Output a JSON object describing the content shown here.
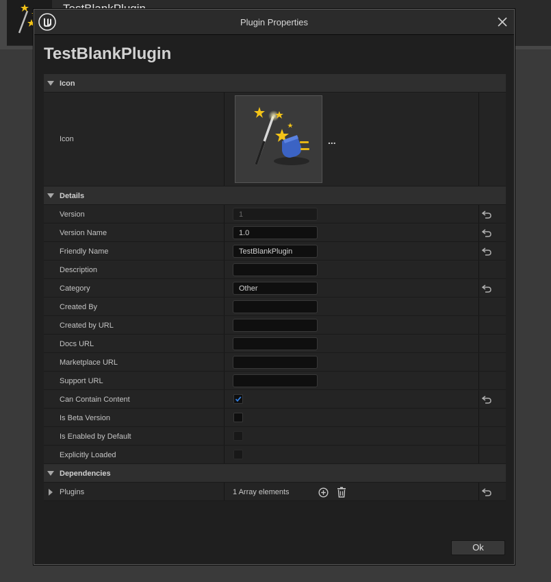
{
  "background_app": {
    "plugin_title": "TestBlankPlugin"
  },
  "dialog": {
    "title": "Plugin Properties",
    "logo_icon": "unreal-engine-logo-icon",
    "close_icon": "close-icon",
    "plugin_name": "TestBlankPlugin"
  },
  "sections": {
    "icon": {
      "header": "Icon",
      "row_label": "Icon",
      "thumbnail_icon": "magic-wand-plugin-icon",
      "browse_label": "..."
    },
    "details": {
      "header": "Details",
      "version": {
        "label": "Version",
        "value": "1"
      },
      "version_name": {
        "label": "Version Name",
        "value": "1.0"
      },
      "friendly_name": {
        "label": "Friendly Name",
        "value": "TestBlankPlugin"
      },
      "description": {
        "label": "Description",
        "value": ""
      },
      "category": {
        "label": "Category",
        "value": "Other"
      },
      "created_by": {
        "label": "Created By",
        "value": ""
      },
      "created_by_url": {
        "label": "Created by URL",
        "value": ""
      },
      "docs_url": {
        "label": "Docs URL",
        "value": ""
      },
      "marketplace_url": {
        "label": "Marketplace URL",
        "value": ""
      },
      "support_url": {
        "label": "Support URL",
        "value": ""
      },
      "can_contain_content": {
        "label": "Can Contain Content",
        "checked": true
      },
      "is_beta_version": {
        "label": "Is Beta Version",
        "checked": false
      },
      "is_enabled_by_default": {
        "label": "Is Enabled by Default",
        "checked": false
      },
      "explicitly_loaded": {
        "label": "Explicitly Loaded",
        "checked": false
      }
    },
    "dependencies": {
      "header": "Dependencies",
      "plugins": {
        "label": "Plugins",
        "count_text": "1 Array elements"
      }
    }
  },
  "footer": {
    "ok_label": "Ok"
  },
  "colors": {
    "dialog_bg": "#1f1f1f",
    "row_bg": "#242424",
    "header_bg": "#2f2f2f",
    "checkbox_accent": "#2f7de0",
    "icon_blue": "#3b63c4",
    "star_yellow": "#f3c318"
  }
}
